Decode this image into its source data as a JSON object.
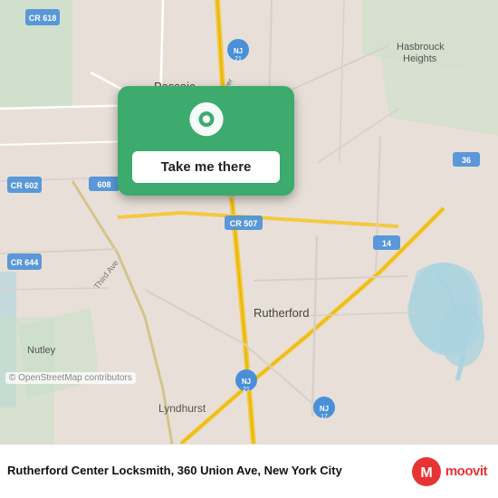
{
  "map": {
    "background_color": "#e8e0d8",
    "attribution": "© OpenStreetMap contributors"
  },
  "location_card": {
    "button_label": "Take me there",
    "accent_color": "#3daa6e"
  },
  "bottom_bar": {
    "place_name": "Rutherford Center Locksmith, 360 Union Ave, New\nYork City",
    "moovit_label": "moovit"
  }
}
